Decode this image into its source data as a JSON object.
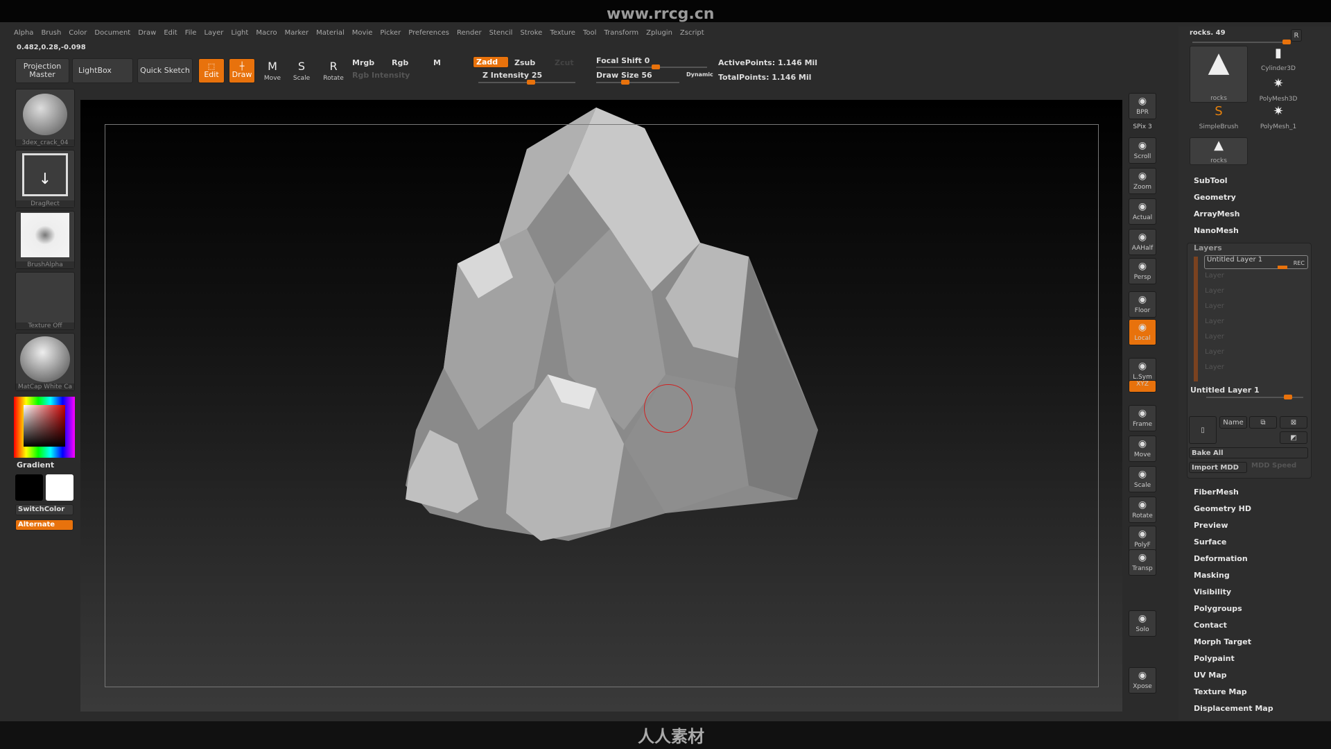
{
  "watermark_top": "www.rrcg.cn",
  "menu": [
    "Alpha",
    "Brush",
    "Color",
    "Document",
    "Draw",
    "Edit",
    "File",
    "Layer",
    "Light",
    "Macro",
    "Marker",
    "Material",
    "Movie",
    "Picker",
    "Preferences",
    "Render",
    "Stencil",
    "Stroke",
    "Texture",
    "Tool",
    "Transform",
    "Zplugin",
    "Zscript"
  ],
  "coords": "0.482,0.28,-0.098",
  "toolbar": {
    "projection_master": "Projection Master",
    "lightbox": "LightBox",
    "quick_sketch": "Quick Sketch",
    "edit": "Edit",
    "draw": "Draw",
    "move": "Move",
    "scale": "Scale",
    "rotate": "Rotate",
    "mrgb": "Mrgb",
    "rgb": "Rgb",
    "m": "M",
    "rgb_intensity": "Rgb Intensity",
    "zadd": "Zadd",
    "zsub": "Zsub",
    "zcut": "Zcut",
    "z_intensity": "Z Intensity 25",
    "focal_shift": "Focal Shift 0",
    "draw_size": "Draw Size 56",
    "dynamic": "Dynamic",
    "active_points": "ActivePoints: 1.146 Mil",
    "total_points": "TotalPoints: 1.146 Mil"
  },
  "left": {
    "brush": "3dex_crack_04",
    "stroke": "DragRect",
    "alpha": "BrushAlpha",
    "texture": "Texture Off",
    "material": "MatCap White Ca",
    "gradient": "Gradient",
    "switch_color": "SwitchColor",
    "alternate": "Alternate"
  },
  "shelf": [
    {
      "label": "BPR",
      "icon": "bpr-icon"
    },
    {
      "label": "SPix 3",
      "icon": ""
    },
    {
      "label": "Scroll",
      "icon": "hand-icon"
    },
    {
      "label": "Zoom",
      "icon": "zoom-icon"
    },
    {
      "label": "Actual",
      "icon": "actual-icon"
    },
    {
      "label": "AAHalf",
      "icon": "aahalf-icon"
    },
    {
      "label": "Persp",
      "icon": "persp-icon"
    },
    {
      "label": "Floor",
      "icon": "floor-icon"
    },
    {
      "label": "Local",
      "icon": "local-icon"
    },
    {
      "label": "L.Sym",
      "icon": "lsym-icon"
    },
    {
      "label": "XYZ",
      "icon": "xyz-icon"
    },
    {
      "label": "Frame",
      "icon": "frame-icon"
    },
    {
      "label": "Move",
      "icon": "move-icon"
    },
    {
      "label": "Scale",
      "icon": "scale-icon"
    },
    {
      "label": "Rotate",
      "icon": "rotate-icon"
    },
    {
      "label": "PolyF",
      "icon": "polyf-icon"
    },
    {
      "label": "Transp",
      "icon": "transp-icon"
    },
    {
      "label": "Solo",
      "icon": "solo-icon"
    },
    {
      "label": "Xpose",
      "icon": "xpose-icon"
    }
  ],
  "tool": {
    "name": "rocks. 49",
    "r": "R",
    "items": [
      "rocks",
      "Cylinder3D",
      "PolyMesh3D",
      "SimpleBrush",
      "PolyMesh_1",
      "rocks"
    ]
  },
  "right_menu_top": [
    "SubTool",
    "Geometry",
    "ArrayMesh",
    "NanoMesh"
  ],
  "layers": {
    "title": "Layers",
    "active": "Untitled Layer 1",
    "rec": "REC",
    "empty": [
      "Layer",
      "Layer",
      "Layer",
      "Layer",
      "Layer",
      "Layer",
      "Layer"
    ],
    "current": "Untitled Layer 1",
    "name": "Name",
    "bake_all": "Bake All",
    "import_mdd": "Import MDD",
    "mdd_speed": "MDD Speed"
  },
  "right_menu_bottom": [
    "FiberMesh",
    "Geometry HD",
    "Preview",
    "Surface",
    "Deformation",
    "Masking",
    "Visibility",
    "Polygroups",
    "Contact",
    "Morph Target",
    "Polypaint",
    "UV Map",
    "Texture Map",
    "Displacement Map"
  ],
  "bottom_logo": "人人素材",
  "colors": {
    "accent": "#e8720c",
    "bg": "#2b2b2b"
  }
}
